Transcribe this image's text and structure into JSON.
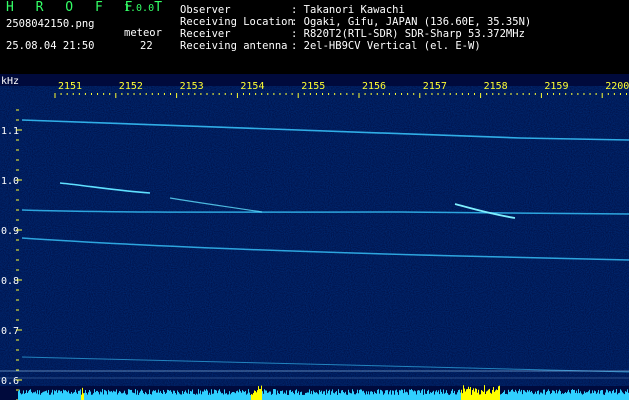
{
  "header": {
    "brand": "H R O F F T",
    "version": "1.0.0",
    "filename": "2508042150.png",
    "datetime": "25.08.04 21:50",
    "counter_label": "meteor",
    "counter_value": "22",
    "info": [
      {
        "key": "Observer",
        "value": ": Takanori Kawachi"
      },
      {
        "key": "Receiving Location",
        "value": ": Ogaki, Gifu, JAPAN (136.60E, 35.35N)"
      },
      {
        "key": "Receiver",
        "value": ": R820T2(RTL-SDR) SDR-Sharp 53.372MHz"
      },
      {
        "key": "Receiving antenna",
        "value": ": 2el-HB9CV Vertical (el. E-W)"
      }
    ]
  },
  "axis": {
    "unit": "kHz",
    "time_labels": [
      "2151",
      "2152",
      "2153",
      "2154",
      "2155",
      "2156",
      "2157",
      "2158",
      "2159",
      "2200"
    ],
    "freq_labels": [
      "1.1",
      "1.0",
      "0.9",
      "0.8",
      "0.7",
      "0.6"
    ]
  },
  "colors": {
    "background": "#000000",
    "spectrum_bg": "#000a3c",
    "axis_text": "#ffff33",
    "header_text": "#ffffff",
    "brand": "#33ff66",
    "signal": "#38c8ff",
    "baseline": "#30d0ff",
    "burst": "#ffff00"
  }
}
